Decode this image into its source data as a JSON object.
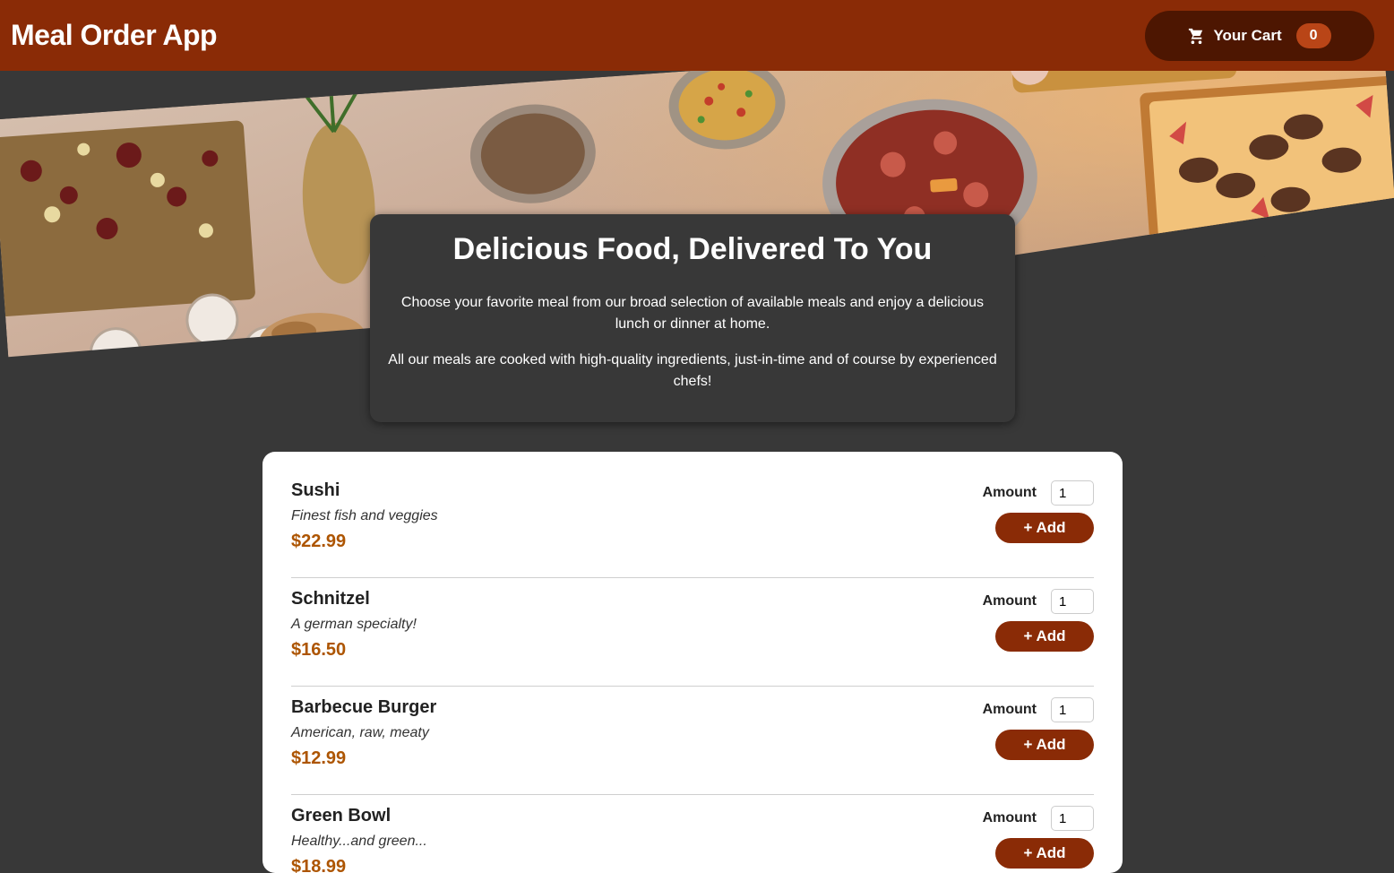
{
  "header": {
    "app_title": "Meal Order App",
    "cart_label": "Your Cart",
    "cart_count": "0"
  },
  "summary": {
    "heading": "Delicious Food, Delivered To You",
    "paragraph1": "Choose your favorite meal from our broad selection of available meals and enjoy a delicious lunch or dinner at home.",
    "paragraph2": "All our meals are cooked with high-quality ingredients, just-in-time and of course by experienced chefs!"
  },
  "meals": [
    {
      "name": "Sushi",
      "description": "Finest fish and veggies",
      "price": "$22.99",
      "amount_label": "Amount",
      "amount_value": "1",
      "add_label": "+ Add"
    },
    {
      "name": "Schnitzel",
      "description": "A german specialty!",
      "price": "$16.50",
      "amount_label": "Amount",
      "amount_value": "1",
      "add_label": "+ Add"
    },
    {
      "name": "Barbecue Burger",
      "description": "American, raw, meaty",
      "price": "$12.99",
      "amount_label": "Amount",
      "amount_value": "1",
      "add_label": "+ Add"
    },
    {
      "name": "Green Bowl",
      "description": "Healthy...and green...",
      "price": "$18.99",
      "amount_label": "Amount",
      "amount_value": "1",
      "add_label": "+ Add"
    }
  ],
  "colors": {
    "header": "#8a2b06",
    "cart_button": "#4d1601",
    "badge": "#b94517",
    "price": "#ad5502",
    "background": "#383838"
  },
  "icons": {
    "cart": "shopping-cart-icon"
  }
}
